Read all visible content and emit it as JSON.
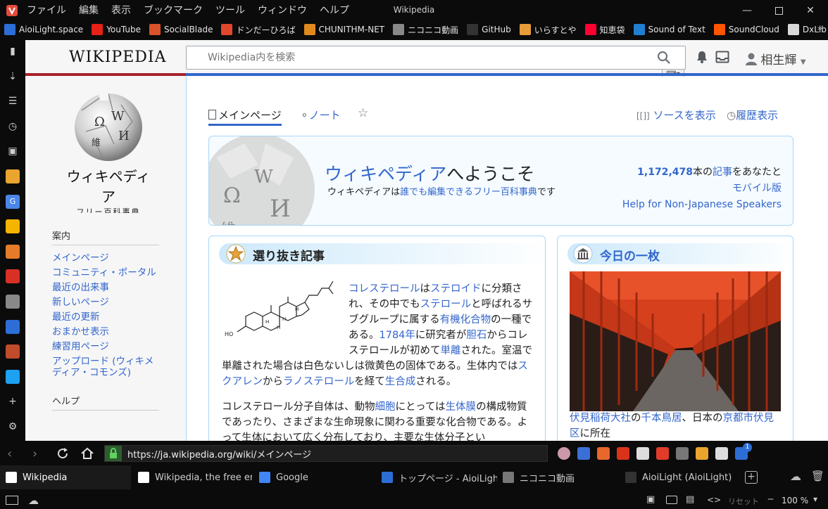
{
  "window": {
    "title": "Wikipedia",
    "minimize": "—",
    "maximize": "☐",
    "close": "✕"
  },
  "menu": [
    "ファイル",
    "編集",
    "表示",
    "ブックマーク",
    "ツール",
    "ウィンドウ",
    "ヘルプ"
  ],
  "bookmarks": [
    {
      "label": "AioiLight.space",
      "color": "#2d6ed6"
    },
    {
      "label": "YouTube",
      "color": "#e62117"
    },
    {
      "label": "SocialBlade",
      "color": "#d8532a"
    },
    {
      "label": "ドンだーひろば",
      "color": "#e2462c"
    },
    {
      "label": "CHUNITHM-NET",
      "color": "#e08a1e"
    },
    {
      "label": "ニコニコ動画",
      "color": "#888888"
    },
    {
      "label": "GitHub",
      "color": "#333333"
    },
    {
      "label": "いらすとや",
      "color": "#e79c3a"
    },
    {
      "label": "知恵袋",
      "color": "#ff0033"
    },
    {
      "label": "Sound of Text",
      "color": "#1f7fd1"
    },
    {
      "label": "SoundCloud",
      "color": "#ff5500"
    },
    {
      "label": "DxLib",
      "color": "#d9d9d9"
    }
  ],
  "bookmarks_more": "»",
  "sidebar": [
    "bookmark-icon",
    "download-icon",
    "notes-icon",
    "history-icon",
    "window-icon",
    "app-icon",
    "translate-icon",
    "app-icon",
    "stats-icon",
    "gmail-icon",
    "web-icon",
    "aioi-icon",
    "game-icon",
    "twitter-icon",
    "add-icon",
    "settings-icon"
  ],
  "wiki": {
    "title": "WIKIPEDIA",
    "search_placeholder": "Wikipedia内を検索",
    "user_name": "相生輝",
    "logo_name": "ウィキペディア",
    "logo_sub": "フリー百科事典",
    "keyboard_glyph": "⌨▾"
  },
  "nav": {
    "heading": "案内",
    "links": [
      "メインページ",
      "コミュニティ・ポータル",
      "最近の出来事",
      "新しいページ",
      "最近の更新",
      "おまかせ表示",
      "練習用ページ",
      "アップロード (ウィキメディア・コモンズ)"
    ],
    "help_heading": "ヘルプ"
  },
  "tabs": {
    "main": "メインページ",
    "talk": "ノート",
    "source": "ソースを表示",
    "history": "履歴表示"
  },
  "welcome": {
    "title_link": "ウィキペディア",
    "title_rest": "へようこそ",
    "sub_pre": "ウィキペディアは",
    "sub_link": "誰でも編集できるフリー百科事典",
    "sub_post": "です",
    "count": "1,172,478",
    "count_mid": "本の",
    "count_link": "記事",
    "count_post": "をあなたと",
    "mobile": "モバイル版",
    "help": "Help for Non-Japanese Speakers"
  },
  "featured": {
    "title": "選り抜き記事",
    "p1": [
      {
        "t": "コレステロール",
        "l": true
      },
      {
        "t": "は",
        "l": false
      },
      {
        "t": "ステロイド",
        "l": true
      },
      {
        "t": "に分類され、その中でも",
        "l": false
      },
      {
        "t": "ステロール",
        "l": true
      },
      {
        "t": "と呼ばれるサブグループに属する",
        "l": false
      },
      {
        "t": "有機化合物",
        "l": true
      },
      {
        "t": "の一種である。",
        "l": false
      },
      {
        "t": "1784年",
        "l": true
      },
      {
        "t": "に研究者が",
        "l": false
      },
      {
        "t": "胆石",
        "l": true
      },
      {
        "t": "からコレステロールが初めて",
        "l": false
      },
      {
        "t": "単離",
        "l": true
      },
      {
        "t": "された。室温で単離された場合は白色ないしは微黄色の固体である。生体内では",
        "l": false
      },
      {
        "t": "スクアレン",
        "l": true
      },
      {
        "t": "から",
        "l": false
      },
      {
        "t": "ラノステロール",
        "l": true
      },
      {
        "t": "を経て",
        "l": false
      },
      {
        "t": "生合成",
        "l": true
      },
      {
        "t": "される。",
        "l": false
      }
    ],
    "p2": [
      {
        "t": "コレステロール分子自体は、動物",
        "l": false
      },
      {
        "t": "細胞",
        "l": true
      },
      {
        "t": "にとっては",
        "l": false
      },
      {
        "t": "生体膜",
        "l": true
      },
      {
        "t": "の構成物質であったり、さまざまな生命現象に関わる重要な化合物である。よって生体において広く分布しており、主要な生体分子とい",
        "l": false
      }
    ]
  },
  "today": {
    "title": "今日の一枚",
    "caption": [
      {
        "t": "伏見稲荷大社",
        "l": true
      },
      {
        "t": "の",
        "l": false
      },
      {
        "t": "千本鳥居",
        "l": true
      },
      {
        "t": "、日本の",
        "l": false
      },
      {
        "t": "京都市",
        "l": true
      },
      {
        "t": "伏見区",
        "l": true
      },
      {
        "t": "に所在",
        "l": false
      }
    ]
  },
  "url": "https://ja.wikipedia.org/wiki/メインページ",
  "browser_tabs": [
    {
      "label": "Wikipedia",
      "active": true
    },
    {
      "label": "Wikipedia, the free encyclopedia",
      "active": false
    },
    {
      "label": "Google",
      "active": false
    },
    {
      "label": "トップページ - AioiLight.space",
      "active": false
    },
    {
      "label": "ニコニコ動画",
      "active": false
    },
    {
      "label": "AioiLight (AioiLight)",
      "active": false
    }
  ],
  "extensions_badge": "1",
  "status": {
    "reset": "リセット",
    "zoom": "100 %"
  }
}
